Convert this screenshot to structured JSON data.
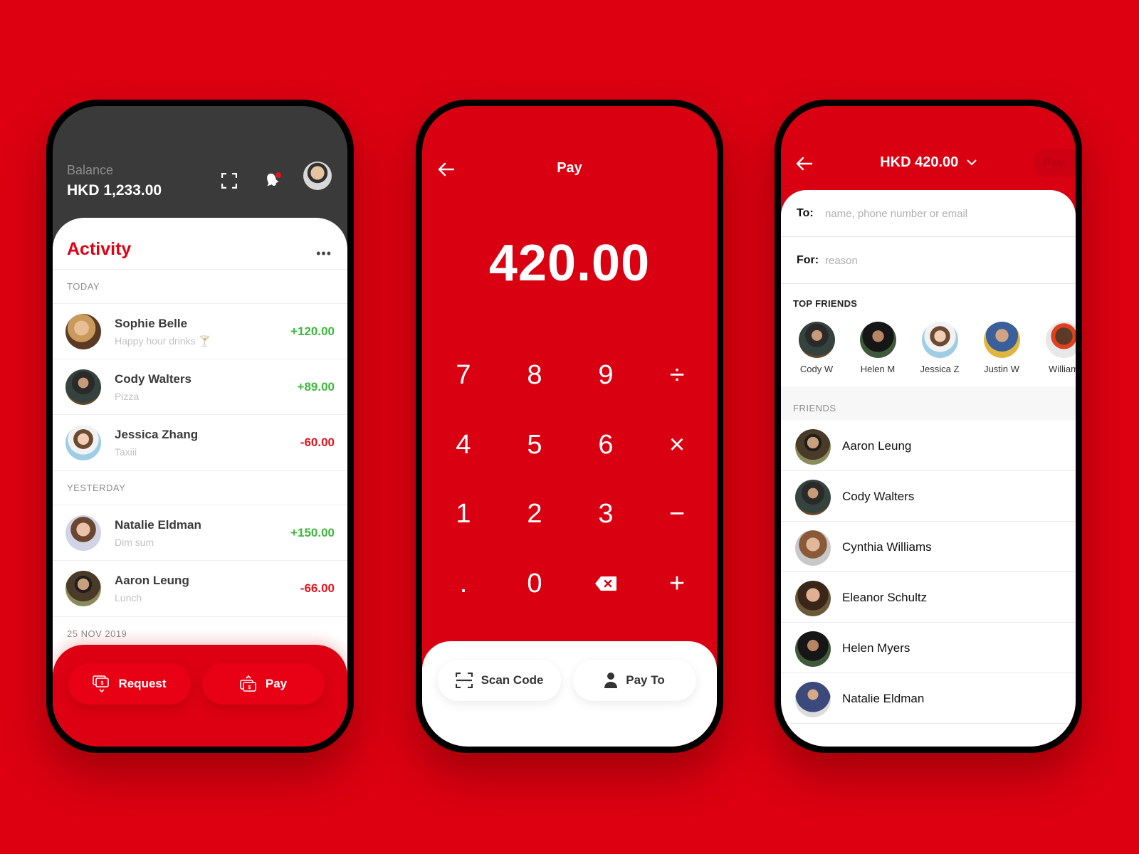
{
  "colors": {
    "background": "#dc0011",
    "accent_red": "#e10013",
    "positive": "#3db83d",
    "negative": "#e0161e",
    "dark_header": "#3a3a3a"
  },
  "activity_screen": {
    "balance_label": "Balance",
    "balance_value": "HKD 1,233.00",
    "header_icons": [
      "scan-icon",
      "notification-bell-icon",
      "profile-avatar"
    ],
    "activity_title": "Activity",
    "more_label": "•••",
    "sections": [
      {
        "label": "TODAY",
        "transactions": [
          {
            "name": "Sophie Belle",
            "note": "Happy hour drinks 🍸",
            "amount": "+120.00",
            "type": "positive"
          },
          {
            "name": "Cody Walters",
            "note": "Pizza",
            "amount": "+89.00",
            "type": "positive"
          },
          {
            "name": "Jessica Zhang",
            "note": "Taxiii",
            "amount": "-60.00",
            "type": "negative"
          }
        ]
      },
      {
        "label": "YESTERDAY",
        "transactions": [
          {
            "name": "Natalie Eldman",
            "note": "Dim sum",
            "amount": "+150.00",
            "type": "positive"
          },
          {
            "name": "Aaron Leung",
            "note": "Lunch",
            "amount": "-66.00",
            "type": "negative"
          }
        ]
      },
      {
        "label": "25 NOV 2019",
        "transactions": []
      }
    ],
    "request_button": "Request",
    "pay_button": "Pay"
  },
  "pay_screen": {
    "title": "Pay",
    "amount": "420.00",
    "keys": [
      "7",
      "8",
      "9",
      "÷",
      "4",
      "5",
      "6",
      "×",
      "1",
      "2",
      "3",
      "−",
      ".",
      "0",
      "backspace",
      "+"
    ],
    "scan_code_button": "Scan Code",
    "pay_to_button": "Pay To"
  },
  "pay_to_screen": {
    "title": "HKD 420.00",
    "pay_button": "Pay",
    "to_label": "To:",
    "to_placeholder": "name, phone number or email",
    "for_label": "For:",
    "for_placeholder": "reason",
    "top_friends_label": "TOP FRIENDS",
    "top_friends": [
      "Cody W",
      "Helen M",
      "Jessica Z",
      "Justin W",
      "William"
    ],
    "friends_label": "FRIENDS",
    "friends": [
      "Aaron Leung",
      "Cody Walters",
      "Cynthia Williams",
      "Eleanor Schultz",
      "Helen Myers",
      "Natalie Eldman"
    ]
  }
}
